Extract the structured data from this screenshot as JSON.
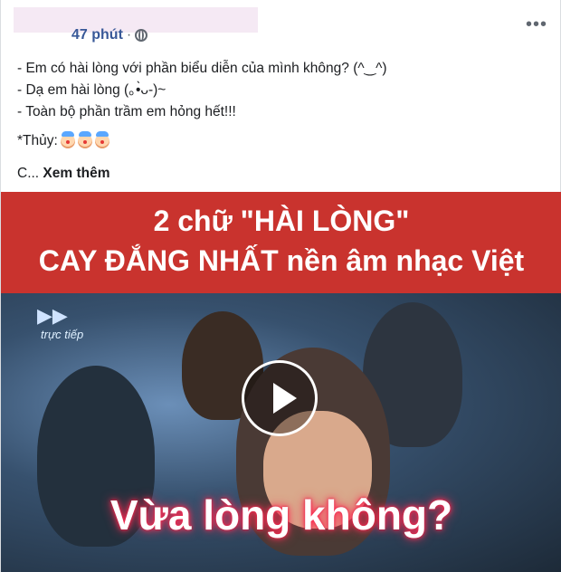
{
  "header": {
    "time": "47 phút",
    "separator": "·"
  },
  "post": {
    "lines": [
      "- Em có hài lòng với phần biểu diễn của mình không? (^‿^)",
      "- Dạ em hài lòng (｡•̀ᴗ-)~",
      "- Toàn bộ phần trầm em hỏng hết!!!"
    ],
    "tag_label": "*Thủy:",
    "see_more_prefix": "C... ",
    "see_more_link": "Xem thêm"
  },
  "video": {
    "title_line1": "2 chữ \"HÀI LÒNG\"",
    "title_line2": "CAY ĐẮNG NHẤT nền âm nhạc Việt",
    "channel_live": "trực tiếp",
    "caption": "Vừa lòng không?"
  },
  "icons": {
    "more": "ellipsis-icon",
    "privacy": "globe-icon",
    "emoji": "clown-face-icon",
    "play": "play-icon"
  },
  "colors": {
    "link": "#385898",
    "banner": "#c9332e",
    "caption_glow": "#ff2d55"
  }
}
